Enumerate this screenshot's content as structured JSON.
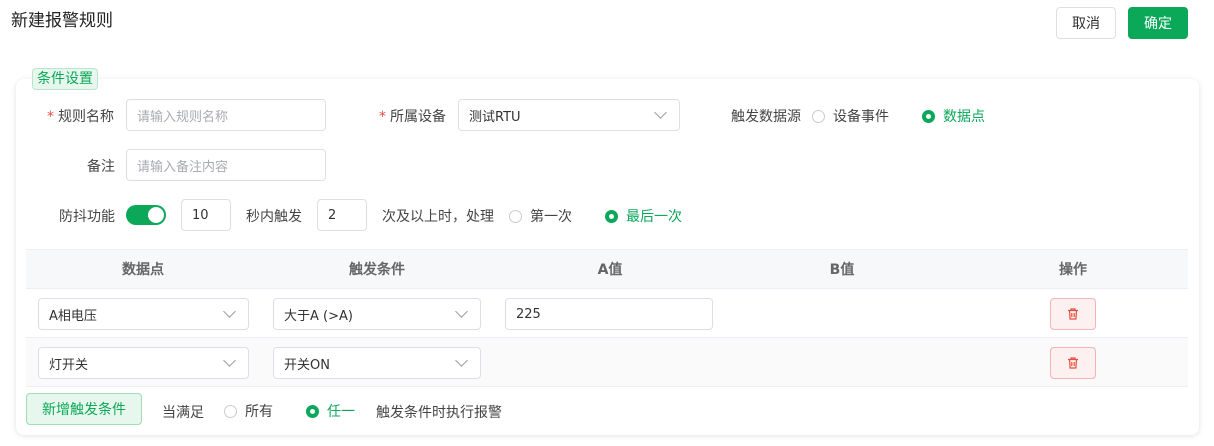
{
  "header": {
    "title": "新建报警规则",
    "cancel_label": "取消",
    "confirm_label": "确定"
  },
  "section": {
    "label": "条件设置"
  },
  "form": {
    "rule_name": {
      "label": "规则名称",
      "placeholder": "请输入规则名称",
      "value": ""
    },
    "device": {
      "label": "所属设备",
      "value": "测试RTU"
    },
    "trigger_source": {
      "label": "触发数据源",
      "options": [
        "设备事件",
        "数据点"
      ],
      "selected": "数据点"
    },
    "remark": {
      "label": "备注",
      "placeholder": "请输入备注内容",
      "value": ""
    },
    "debounce": {
      "label": "防抖功能",
      "enabled": true,
      "seconds": "10",
      "seconds_suffix": "秒内触发",
      "count": "2",
      "count_suffix": "次及以上时，处理",
      "options": [
        "第一次",
        "最后一次"
      ],
      "selected": "最后一次"
    }
  },
  "table": {
    "columns": [
      "数据点",
      "触发条件",
      "A值",
      "B值",
      "操作"
    ],
    "rows": [
      {
        "point": "A相电压",
        "condition": "大于A (>A)",
        "a_value": "225",
        "b_value": ""
      },
      {
        "point": "灯开关",
        "condition": "开关ON",
        "a_value": "",
        "b_value": ""
      }
    ]
  },
  "footer": {
    "add_label": "新增触发条件",
    "when_label": "当满足",
    "options": [
      "所有",
      "任一"
    ],
    "selected": "任一",
    "suffix": "触发条件时执行报警"
  },
  "colors": {
    "accent": "#0aa858",
    "danger": "#e74c3c",
    "required": "#e74c3c"
  },
  "icons": {
    "delete": "trash-icon",
    "dropdown": "chevron-down-icon"
  }
}
